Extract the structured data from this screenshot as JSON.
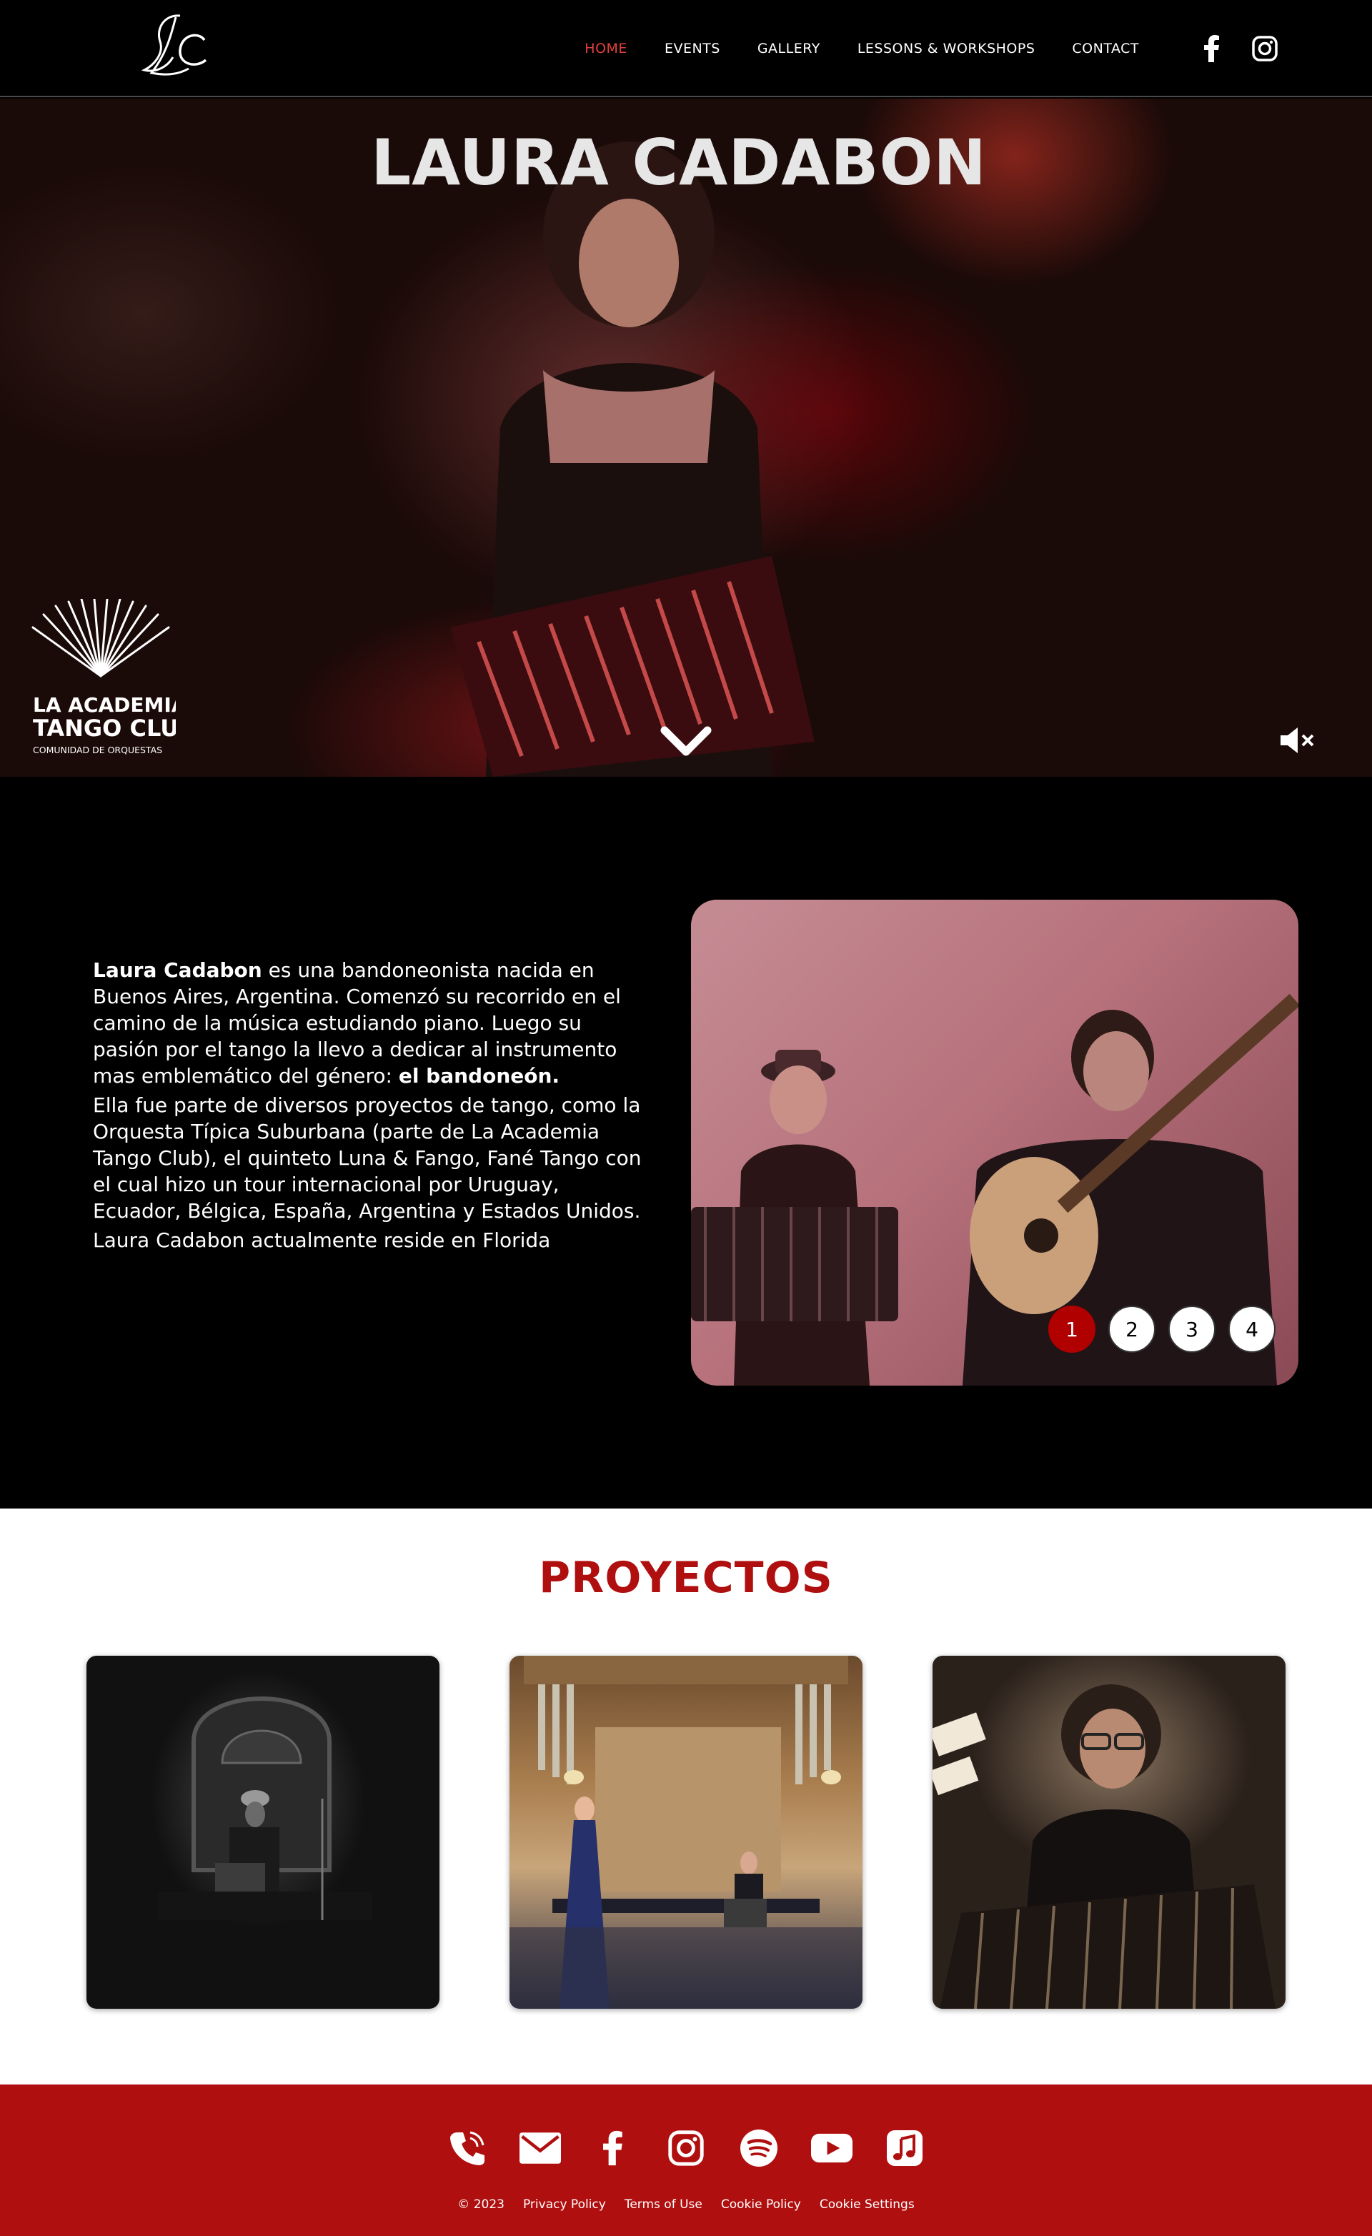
{
  "header": {
    "logo_text": "LC",
    "nav": [
      {
        "label": "HOME",
        "active": true
      },
      {
        "label": "EVENTS",
        "active": false
      },
      {
        "label": "GALLERY",
        "active": false
      },
      {
        "label": "LESSONS & WORKSHOPS",
        "active": false
      },
      {
        "label": "CONTACT",
        "active": false
      }
    ],
    "social": [
      "facebook-icon",
      "instagram-icon"
    ]
  },
  "hero": {
    "title": "LAURA CADABON",
    "brand_line1": "LA ACADEMIA",
    "brand_line2": "TANGO CLUB",
    "brand_line3": "COMUNIDAD DE ORQUESTAS"
  },
  "about": {
    "p1_name": "Laura Cadabon",
    "p1_text": " es una bandoneonista nacida en Buenos Aires, Argentina. Comenzó su recorrido en el camino de la música estudiando piano. Luego su pasión por el tango la llevo a dedicar al instrumento mas emblemático del género: ",
    "p1_bold_end": "el bandoneón.",
    "p2": "Ella fue parte de diversos proyectos de tango, como la Orquesta Típica Suburbana (parte de La Academia Tango Club), el quinteto Luna & Fango, Fané Tango con el cual hizo un tour internacional por Uruguay, Ecuador, Bélgica, España, Argentina y Estados Unidos.",
    "p3": "Laura Cadabon actualmente reside en Florida",
    "slider_dots": [
      "1",
      "2",
      "3",
      "4"
    ],
    "slider_active": "1"
  },
  "projects": {
    "title": "PROYECTOS"
  },
  "footer": {
    "icons": [
      "phone-icon",
      "mail-icon",
      "facebook-icon",
      "instagram-icon",
      "spotify-icon",
      "youtube-icon",
      "itunes-icon"
    ],
    "copyright": "© 2023",
    "links": [
      "Privacy Policy",
      "Terms of Use",
      "Cookie Policy",
      "Cookie Settings"
    ]
  },
  "colors": {
    "accent_red": "#b00f0f",
    "nav_active": "#e0403a",
    "background": "#000000"
  }
}
